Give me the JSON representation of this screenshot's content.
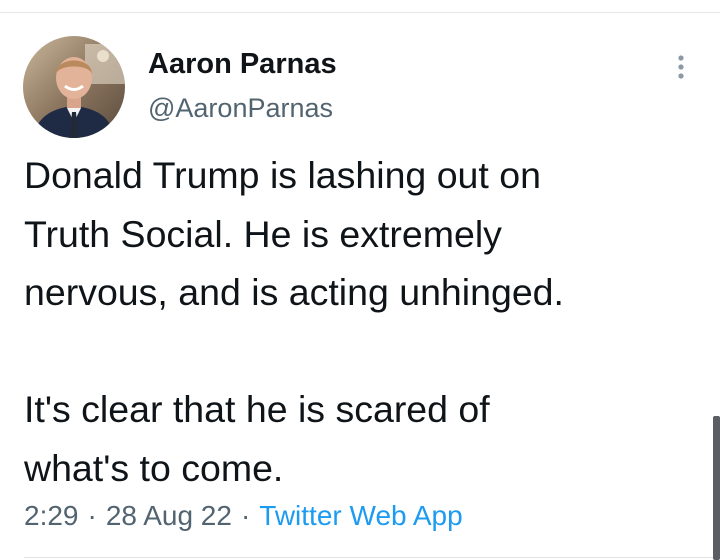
{
  "tweet": {
    "author": {
      "display_name": "Aaron Parnas",
      "handle": "@AaronParnas"
    },
    "text": "Donald Trump is lashing out on\nTruth Social. He is extremely\nnervous, and is acting unhinged.\n\nIt's clear that he is scared of\nwhat's to come.",
    "time": "2:29",
    "date": "28 Aug 22",
    "separator": "·",
    "source": "Twitter Web App"
  },
  "icons": {
    "more": "more-vertical-icon",
    "avatar": "user-avatar"
  },
  "colors": {
    "text": "#0f1419",
    "secondary": "#536471",
    "link": "#1d9bf0"
  }
}
